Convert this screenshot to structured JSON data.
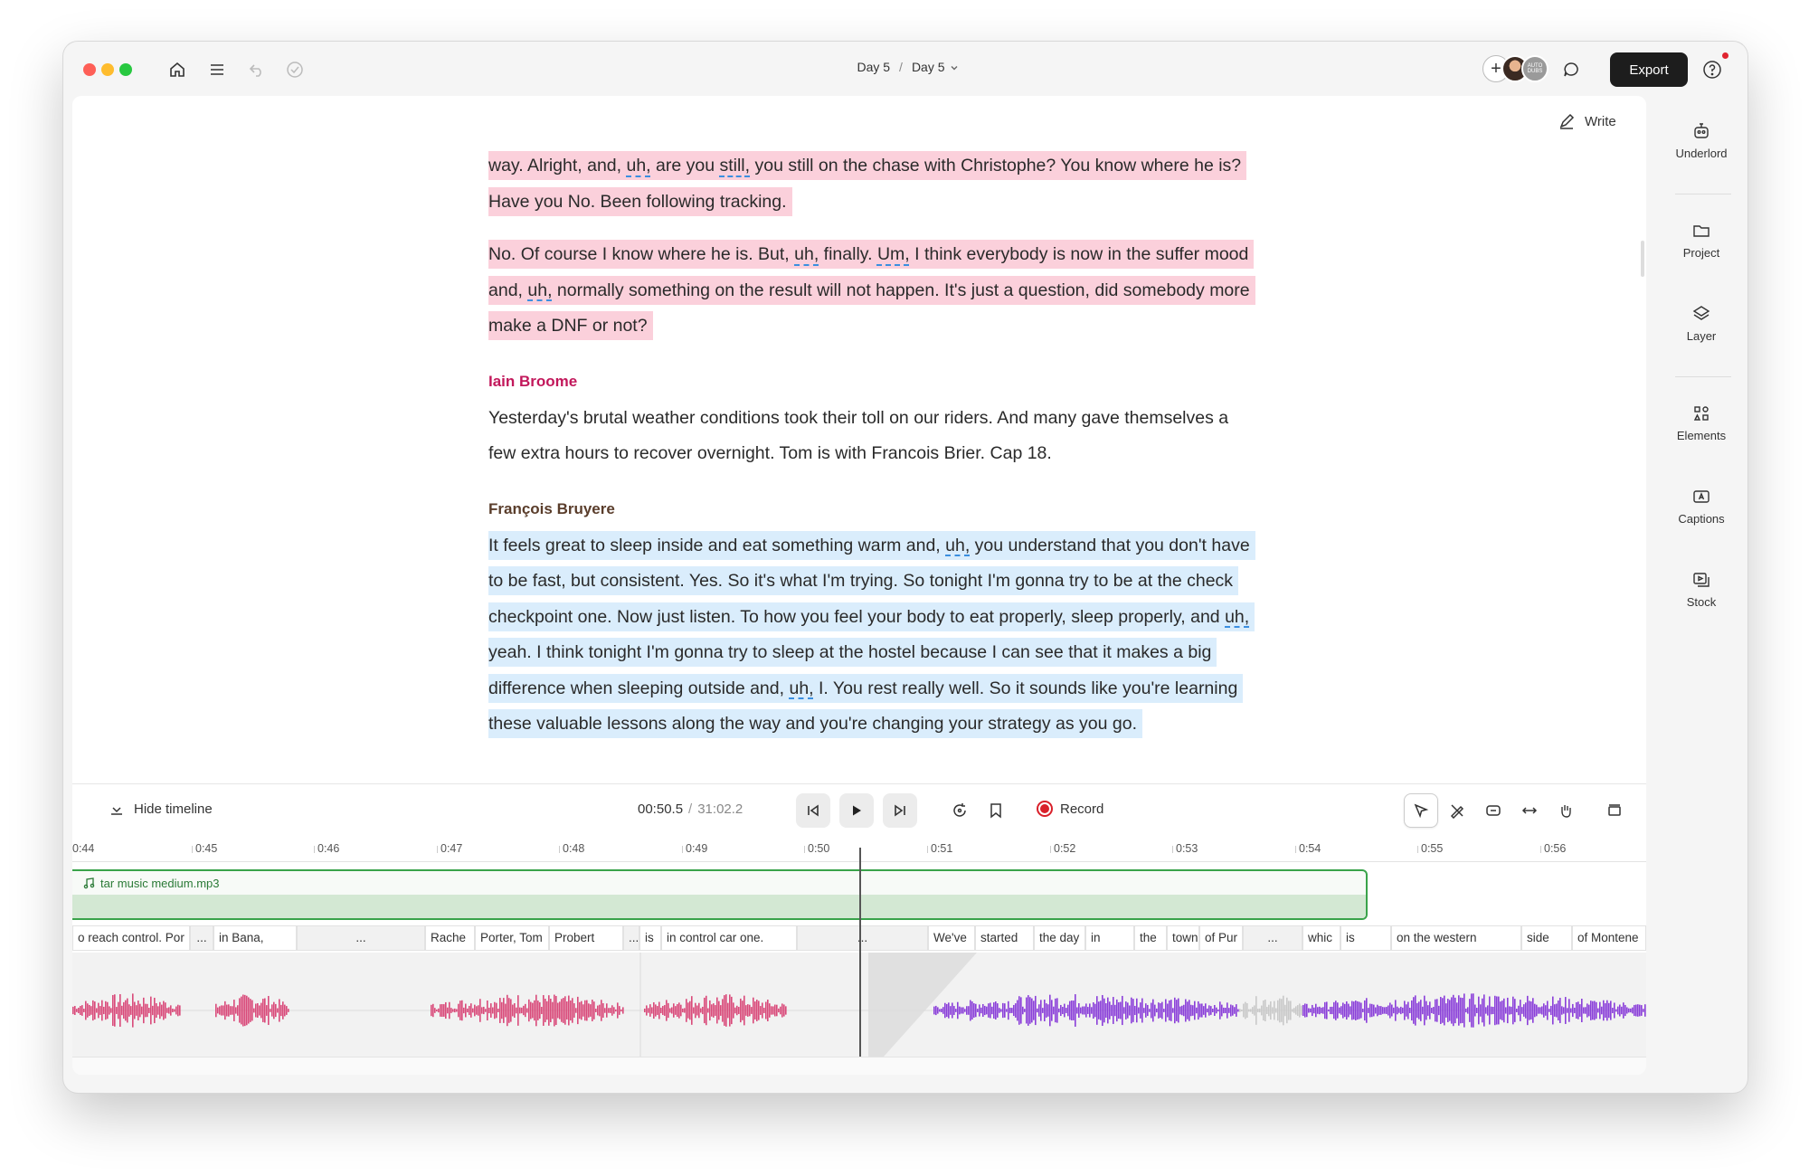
{
  "titlebar": {
    "breadcrumb_project": "Day 5",
    "breadcrumb_separator": "/",
    "breadcrumb_composition": "Day 5",
    "export_label": "Export",
    "avatar_initials": "AUTO DUBS"
  },
  "editor": {
    "write_label": "Write",
    "paragraphs": [
      {
        "text_a": "way. Alright, and, ",
        "filler_1": "uh,",
        "text_b": " are you ",
        "filler_2": "still,",
        "text_c": " you still on the chase with Christophe? You know where he is? Have you No. Been following tracking."
      },
      {
        "text_a": "No. Of course I know where he is. But, ",
        "filler_1": "uh,",
        "text_b": " finally. ",
        "filler_2": "Um,",
        "text_c": " I think everybody is now in the suffer mood and, ",
        "filler_3": "uh,",
        "text_d": " normally something on the result will not happen. It's just a question, did somebody more make a DNF or not?"
      }
    ],
    "speaker_1": {
      "name": "Iain Broome",
      "text": "Yesterday's brutal weather conditions took their toll on our riders. And many gave themselves a few extra hours to recover overnight. Tom is with Francois Brier. Cap 18."
    },
    "speaker_2": {
      "name": "François Bruyere",
      "text_a": "It feels great to sleep inside and eat something warm and, ",
      "filler_1": "uh,",
      "text_b": " you understand that you don't have to be fast, but consistent. Yes. So it's what I'm trying. So tonight I'm gonna try to be at the check checkpoint one. Now just listen. To how you feel your body to eat properly, sleep properly, and ",
      "filler_2": "uh,",
      "text_c": " yeah. I think tonight I'm gonna try to sleep at the hostel because I can see that it makes a big difference when sleeping outside and, ",
      "filler_3": "uh,",
      "text_d": " I. You rest really well. So it sounds like you're learning these valuable lessons along the way and you're changing your strategy as you go."
    },
    "speaker_colors": {
      "iain": "#c2185b",
      "francois": "#5a3d2b"
    },
    "highlight_colors": {
      "pink": "#fbd0db",
      "blue": "#daedfc"
    }
  },
  "sidebar": {
    "items": [
      {
        "label": "Underlord",
        "icon": "robot-icon"
      },
      {
        "label": "Project",
        "icon": "folder-icon"
      },
      {
        "label": "Layer",
        "icon": "layers-icon"
      },
      {
        "label": "Elements",
        "icon": "elements-icon"
      },
      {
        "label": "Captions",
        "icon": "captions-icon"
      },
      {
        "label": "Stock",
        "icon": "stock-icon"
      }
    ]
  },
  "timeline": {
    "hide_label": "Hide timeline",
    "current_time": "00:50.5",
    "total_time": "31:02.2",
    "record_label": "Record",
    "ruler_ticks": [
      "0:44",
      "0:45",
      "0:46",
      "0:47",
      "0:48",
      "0:49",
      "0:50",
      "0:51",
      "0:52",
      "0:53",
      "0:54",
      "0:55",
      "0:56"
    ],
    "music_track": "tar music medium.mp3",
    "words": [
      "o reach control. Por",
      "...",
      "in Bana,",
      "...",
      "Rache",
      "Porter, Tom",
      "Probert",
      "...",
      "is",
      "in control car one.",
      "...",
      "We've",
      "started",
      "the day",
      "in",
      "the",
      "town",
      "of Pur",
      "...",
      "whic",
      "is",
      "on the western",
      "side",
      "of Montene"
    ],
    "wave_colors": {
      "speaker_1": "#d94a7a",
      "speaker_2": "#8a3fd9",
      "muted": "#c9c9c9"
    }
  }
}
